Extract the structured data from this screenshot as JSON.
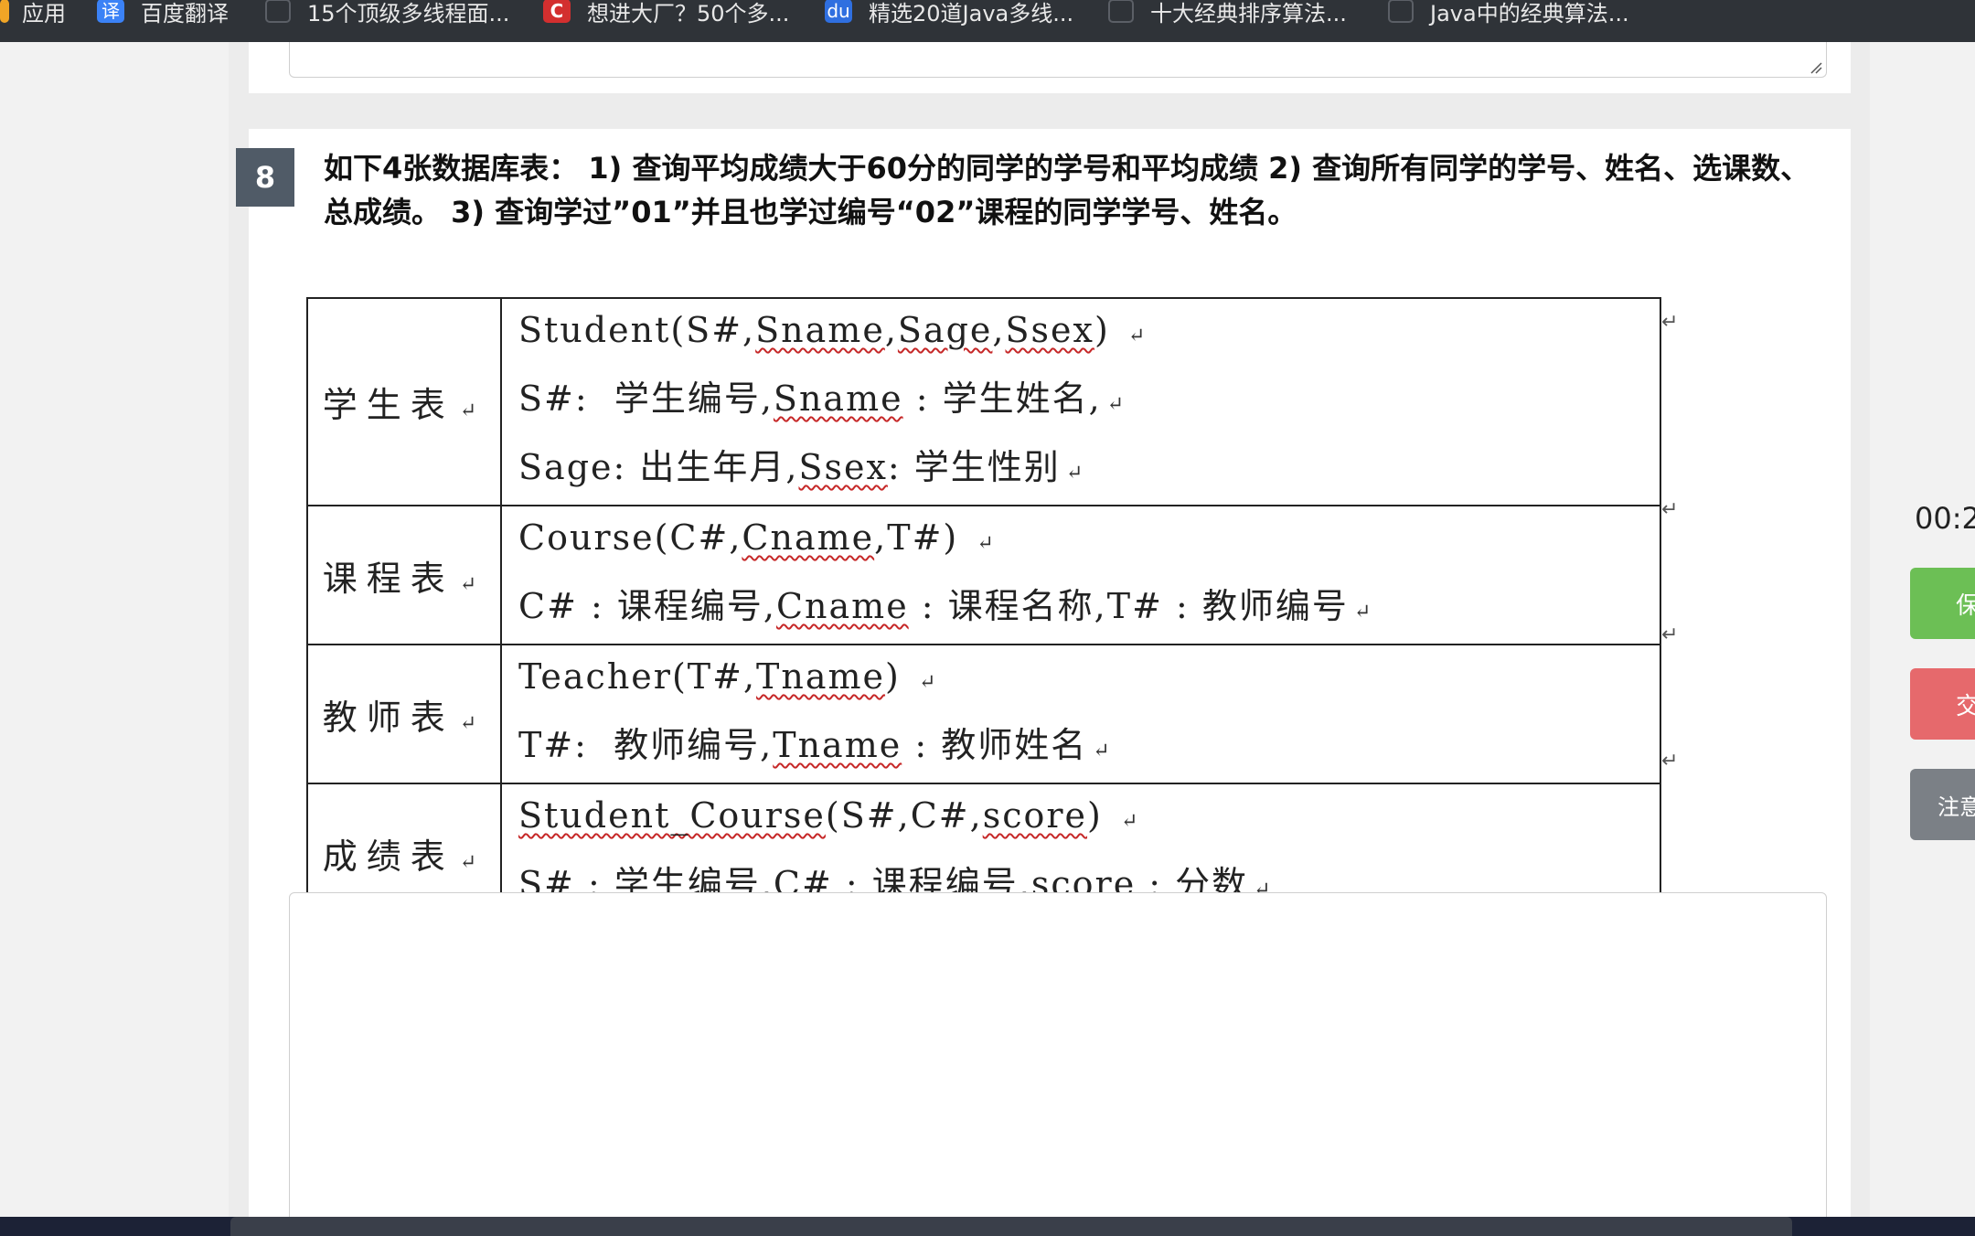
{
  "bookmarks": [
    {
      "label": "应用",
      "icon": "apps-grid-icon"
    },
    {
      "label": "百度翻译",
      "icon": "fanyi-icon",
      "glyph": "译"
    },
    {
      "label": "15个顶级多线程面...",
      "icon": "page-icon"
    },
    {
      "label": "想进大厂？50个多...",
      "icon": "csdn-icon",
      "glyph": "C"
    },
    {
      "label": "精选20道Java多线...",
      "icon": "baidu-icon",
      "glyph": "du"
    },
    {
      "label": "十大经典排序算法...",
      "icon": "page-icon"
    },
    {
      "label": "Java中的经典算法...",
      "icon": "page-icon"
    }
  ],
  "question": {
    "number": "8",
    "text": "如下4张数据库表： 1) 查询平均成绩大于60分的同学的学号和平均成绩 2) 查询所有同学的学号、姓名、选课数、总成绩。 3) 查询学过”01”并且也学过编号“02”课程的同学学号、姓名。"
  },
  "schema_table": [
    {
      "label": "学生表",
      "lines": [
        "Student(S#,Sname,Sage,Ssex)",
        "S#:  学生编号,Sname : 学生姓名,",
        "Sage: 出生年月,Ssex: 学生性别"
      ]
    },
    {
      "label": "课程表",
      "lines": [
        "Course(C#,Cname,T#)",
        "C# : 课程编号,Cname : 课程名称,T# : 教师编号"
      ]
    },
    {
      "label": "教师表",
      "lines": [
        "Teacher(T#,Tname)",
        "T#:  教师编号,Tname : 教师姓名"
      ]
    },
    {
      "label": "成绩表",
      "lines": [
        "Student_Course(S#,C#,score)",
        "S# : 学生编号,C# : 课程编号,score : 分数"
      ]
    }
  ],
  "return_mark": "↵",
  "sidebar": {
    "timer": "00:2",
    "save_label": "保",
    "submit_label": "交",
    "note_label": "注意"
  },
  "colors": {
    "save": "#6cbf55",
    "submit": "#e6696c",
    "note": "#7b8086",
    "question_number_bg": "#505b67"
  }
}
